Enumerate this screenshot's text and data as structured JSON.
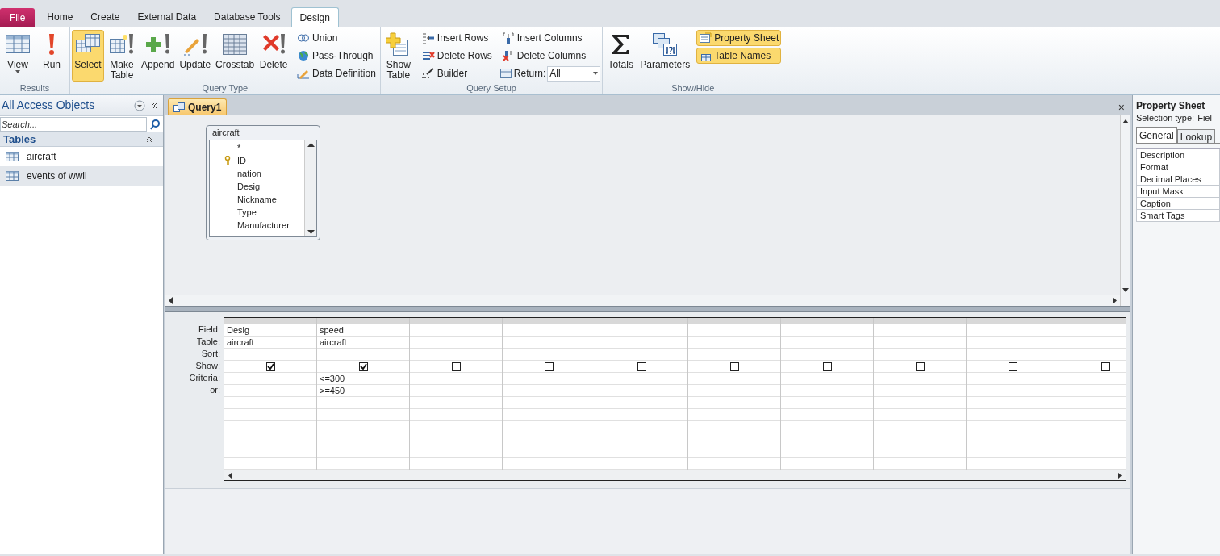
{
  "tabs": [
    {
      "label": "File",
      "kind": "file",
      "selected": false
    },
    {
      "label": "Home",
      "kind": "tab",
      "selected": false
    },
    {
      "label": "Create",
      "kind": "tab",
      "selected": false
    },
    {
      "label": "External Data",
      "kind": "tab",
      "selected": false
    },
    {
      "label": "Database Tools",
      "kind": "tab",
      "selected": false
    },
    {
      "label": "Design",
      "kind": "tab",
      "selected": true
    }
  ],
  "ribbon_groups": [
    {
      "label": "Results",
      "buttons": [
        {
          "label": "View",
          "kind": "large",
          "dropdown": true,
          "selected": false
        },
        {
          "label": "Run",
          "kind": "large",
          "selected": false
        }
      ]
    },
    {
      "label": "Query Type",
      "buttons": [
        {
          "label": "Select",
          "kind": "large",
          "selected": true
        },
        {
          "label": "Make Table",
          "kind": "large",
          "selected": false
        },
        {
          "label": "Append",
          "kind": "large",
          "selected": false
        },
        {
          "label": "Update",
          "kind": "large",
          "selected": false
        },
        {
          "label": "Crosstab",
          "kind": "large",
          "selected": false
        },
        {
          "label": "Delete",
          "kind": "large",
          "selected": false
        },
        {
          "label": "Union",
          "kind": "small",
          "selected": false
        },
        {
          "label": "Pass-Through",
          "kind": "small",
          "selected": false
        },
        {
          "label": "Data Definition",
          "kind": "small",
          "selected": false
        }
      ]
    },
    {
      "label": "Query Setup",
      "buttons": [
        {
          "label": "Show Table",
          "kind": "large",
          "selected": false
        },
        {
          "label": "Insert Rows",
          "kind": "small",
          "selected": false
        },
        {
          "label": "Delete Rows",
          "kind": "small",
          "selected": false
        },
        {
          "label": "Builder",
          "kind": "small",
          "selected": false
        },
        {
          "label": "Insert Columns",
          "kind": "small",
          "selected": false
        },
        {
          "label": "Delete Columns",
          "kind": "small",
          "selected": false
        },
        {
          "label": "Return:",
          "kind": "combo",
          "value": "All"
        }
      ]
    },
    {
      "label": "Show/Hide",
      "buttons": [
        {
          "label": "Totals",
          "kind": "large",
          "selected": false
        },
        {
          "label": "Parameters",
          "kind": "large",
          "selected": false
        },
        {
          "label": "Property Sheet",
          "kind": "small",
          "selected": true
        },
        {
          "label": "Table Names",
          "kind": "small",
          "selected": true
        }
      ]
    }
  ],
  "nav_pane": {
    "title": "All Access Objects",
    "search": {
      "placeholder": "Search..."
    },
    "group": "Tables",
    "items": [
      {
        "label": "aircraft",
        "selected": false
      },
      {
        "label": "events of wwii",
        "selected": true
      }
    ]
  },
  "document_tab": "Query1",
  "close_glyph": "×",
  "table_box": {
    "title": "aircraft",
    "fields": [
      {
        "name": "*",
        "key": false
      },
      {
        "name": "ID",
        "key": true
      },
      {
        "name": "nation",
        "key": false
      },
      {
        "name": "Desig",
        "key": false
      },
      {
        "name": "Nickname",
        "key": false
      },
      {
        "name": "Type",
        "key": false
      },
      {
        "name": "Manufacturer",
        "key": false
      }
    ]
  },
  "grid": {
    "row_labels": [
      "Field:",
      "Table:",
      "Sort:",
      "Show:",
      "Criteria:",
      "or:"
    ],
    "columns": [
      {
        "field": "Desig",
        "table": "aircraft",
        "show": true
      },
      {
        "field": "speed",
        "table": "aircraft",
        "show": true,
        "criteria": "<=300",
        "or": ">=450"
      },
      {
        "show": false
      },
      {
        "show": false
      },
      {
        "show": false
      },
      {
        "show": false
      },
      {
        "show": false
      },
      {
        "show": false
      },
      {
        "show": false
      },
      {
        "show": false
      }
    ]
  },
  "property_sheet": {
    "title": "Property Sheet",
    "selection_label": "Selection type:",
    "selection_value": "Fiel",
    "tabs": [
      {
        "label": "General",
        "selected": true
      },
      {
        "label": "Lookup",
        "selected": false
      }
    ],
    "properties": [
      "Description",
      "Format",
      "Decimal Places",
      "Input Mask",
      "Caption",
      "Smart Tags"
    ]
  }
}
